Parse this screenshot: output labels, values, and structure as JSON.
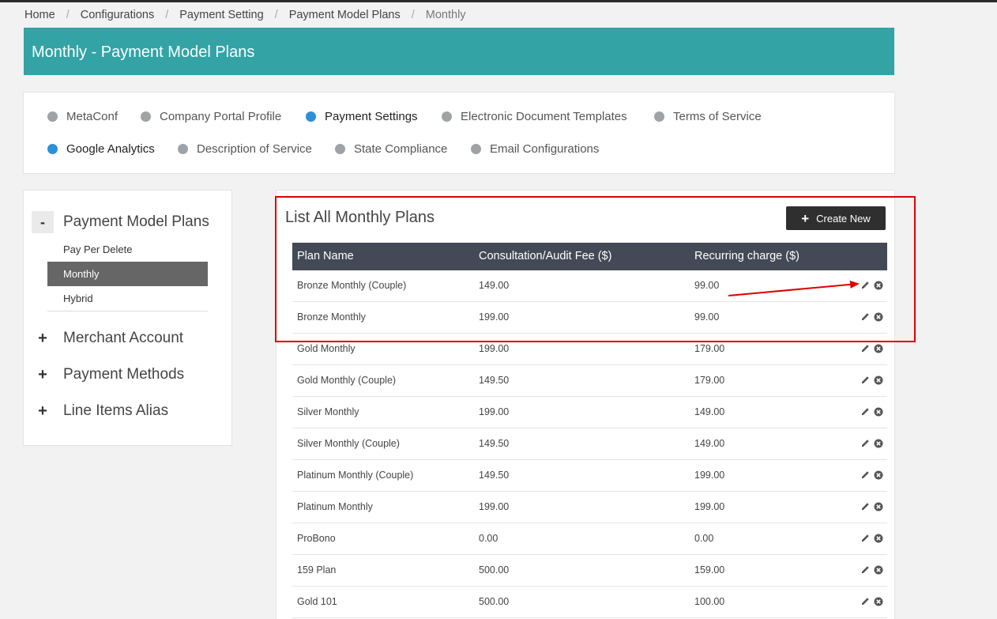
{
  "breadcrumb": {
    "items": [
      "Home",
      "Configurations",
      "Payment Setting",
      "Payment Model Plans",
      "Monthly"
    ],
    "separator": "/"
  },
  "header": {
    "title": "Monthly - Payment Model Plans",
    "bg_color": "#33a3a6"
  },
  "config_nav": {
    "items": [
      {
        "label": "MetaConf",
        "active": false
      },
      {
        "label": "Company Portal Profile",
        "active": false
      },
      {
        "label": "Payment Settings",
        "active": true
      },
      {
        "label": "Electronic Document Templates",
        "active": false
      },
      {
        "label": "Terms of Service",
        "active": false
      },
      {
        "label": "Google Analytics",
        "active": true
      },
      {
        "label": "Description of Service",
        "active": false
      },
      {
        "label": "State Compliance",
        "active": false
      },
      {
        "label": "Email Configurations",
        "active": false
      }
    ]
  },
  "sidebar": {
    "sections": [
      {
        "label": "Payment Model Plans",
        "toggle": "-",
        "expanded": true
      },
      {
        "label": "Merchant Account",
        "toggle": "+",
        "expanded": false
      },
      {
        "label": "Payment Methods",
        "toggle": "+",
        "expanded": false
      },
      {
        "label": "Line Items Alias",
        "toggle": "+",
        "expanded": false
      }
    ],
    "sub_items": [
      {
        "label": "Pay Per Delete",
        "selected": false
      },
      {
        "label": "Monthly",
        "selected": true
      },
      {
        "label": "Hybrid",
        "selected": false
      }
    ]
  },
  "main": {
    "title": "List All Monthly Plans",
    "create_button": {
      "label": "Create New",
      "icon": "plus-icon"
    },
    "table": {
      "columns": [
        "Plan Name",
        "Consultation/Audit Fee ($)",
        "Recurring charge ($)"
      ],
      "rows": [
        {
          "name": "Bronze Monthly (Couple)",
          "fee": "149.00",
          "recurring": "99.00"
        },
        {
          "name": "Bronze Monthly",
          "fee": "199.00",
          "recurring": "99.00"
        },
        {
          "name": "Gold Monthly",
          "fee": "199.00",
          "recurring": "179.00"
        },
        {
          "name": "Gold Monthly (Couple)",
          "fee": "149.50",
          "recurring": "179.00"
        },
        {
          "name": "Silver Monthly",
          "fee": "199.00",
          "recurring": "149.00"
        },
        {
          "name": "Silver Monthly (Couple)",
          "fee": "149.50",
          "recurring": "149.00"
        },
        {
          "name": "Platinum Monthly (Couple)",
          "fee": "149.50",
          "recurring": "199.00"
        },
        {
          "name": "Platinum Monthly",
          "fee": "199.00",
          "recurring": "199.00"
        },
        {
          "name": "ProBono",
          "fee": "0.00",
          "recurring": "0.00"
        },
        {
          "name": "159 Plan",
          "fee": "500.00",
          "recurring": "159.00"
        },
        {
          "name": "Gold 101",
          "fee": "500.00",
          "recurring": "100.00"
        }
      ],
      "row_actions": [
        "edit-icon",
        "delete-icon"
      ]
    }
  },
  "annotation": {
    "color": "#e00000",
    "type": "highlight-box-with-arrow"
  }
}
